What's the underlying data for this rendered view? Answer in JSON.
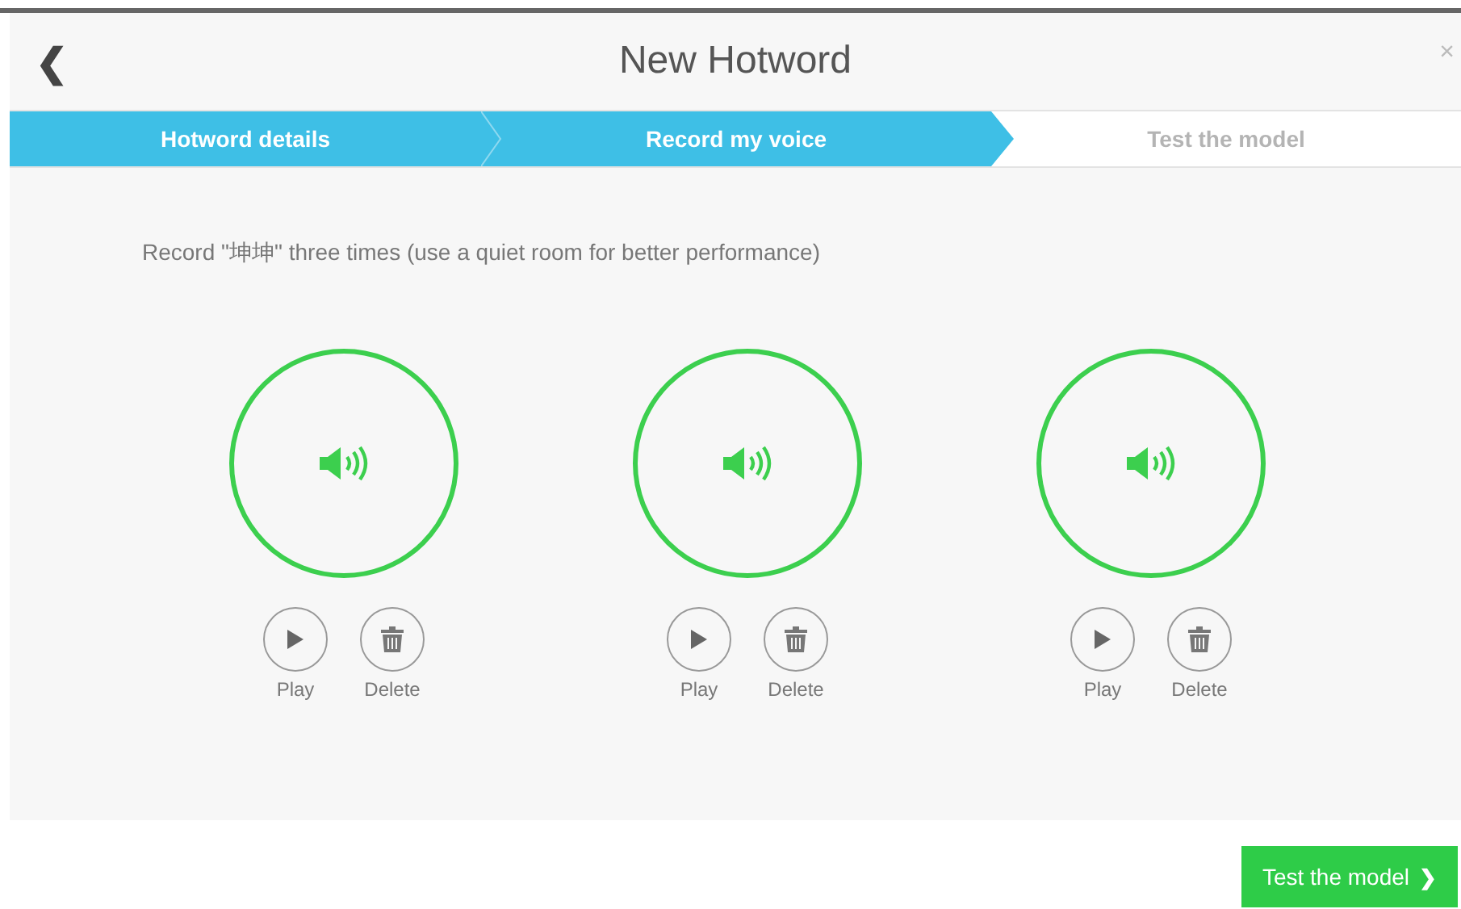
{
  "dialog": {
    "title": "New Hotword",
    "back": "❮",
    "close": "×"
  },
  "steps": [
    {
      "label": "Hotword details",
      "reached": true
    },
    {
      "label": "Record my voice",
      "reached": true
    },
    {
      "label": "Test the model",
      "reached": false
    }
  ],
  "instruction": "Record \"坤坤\" three times (use a quiet room for better performance)",
  "recordings": [
    {
      "recorded": true,
      "play": "Play",
      "delete": "Delete"
    },
    {
      "recorded": true,
      "play": "Play",
      "delete": "Delete"
    },
    {
      "recorded": true,
      "play": "Play",
      "delete": "Delete"
    }
  ],
  "next_button": {
    "label": "Test the model",
    "arrow": "❯"
  }
}
